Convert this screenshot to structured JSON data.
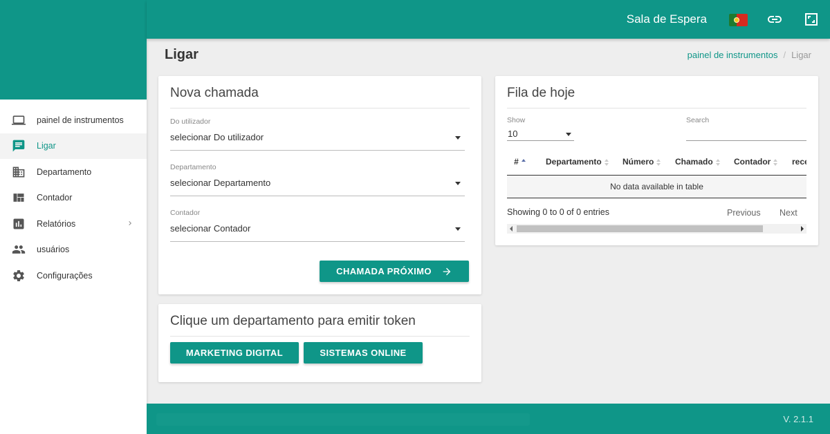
{
  "colors": {
    "accent": "#0f9688",
    "active_bg": "#f3f3f3"
  },
  "topbar": {
    "title": "Sala de Espera",
    "icons": [
      "portugal-flag-icon",
      "link-icon",
      "fullscreen-icon"
    ]
  },
  "sidebar": {
    "items": [
      {
        "label": "painel de instrumentos",
        "icon": "laptop-icon",
        "active": false
      },
      {
        "label": "Ligar",
        "icon": "chat-icon",
        "active": true
      },
      {
        "label": "Departamento",
        "icon": "building-icon",
        "active": false
      },
      {
        "label": "Contador",
        "icon": "dashboard-icon",
        "active": false
      },
      {
        "label": "Relatórios",
        "icon": "bar-chart-icon",
        "active": false,
        "has_submenu": true
      },
      {
        "label": "usuários",
        "icon": "people-icon",
        "active": false
      },
      {
        "label": "Configurações",
        "icon": "gear-icon",
        "active": false
      }
    ]
  },
  "page": {
    "title": "Ligar",
    "breadcrumb": {
      "link": "painel de instrumentos",
      "separator": "/",
      "current": "Ligar"
    }
  },
  "new_call": {
    "title": "Nova chamada",
    "fields": [
      {
        "label": "Do utilizador",
        "value": "selecionar Do utilizador"
      },
      {
        "label": "Departamento",
        "value": "selecionar Departamento"
      },
      {
        "label": "Contador",
        "value": "selecionar Contador"
      }
    ],
    "next_button": "CHAMADA PRÓXIMO"
  },
  "tokens": {
    "title": "Clique um departamento para emitir token",
    "buttons": [
      "MARKETING DIGITAL",
      "SISTEMAS ONLINE"
    ]
  },
  "queue": {
    "title": "Fila de hoje",
    "show_label": "Show",
    "show_value": "10",
    "search_label": "Search",
    "columns": [
      "#",
      "Departamento",
      "Número",
      "Chamado",
      "Contador",
      "rece"
    ],
    "empty": "No data available in table",
    "info": "Showing 0 to 0 of 0 entries",
    "previous": "Previous",
    "next": "Next"
  },
  "footer": {
    "version": "V. 2.1.1"
  }
}
